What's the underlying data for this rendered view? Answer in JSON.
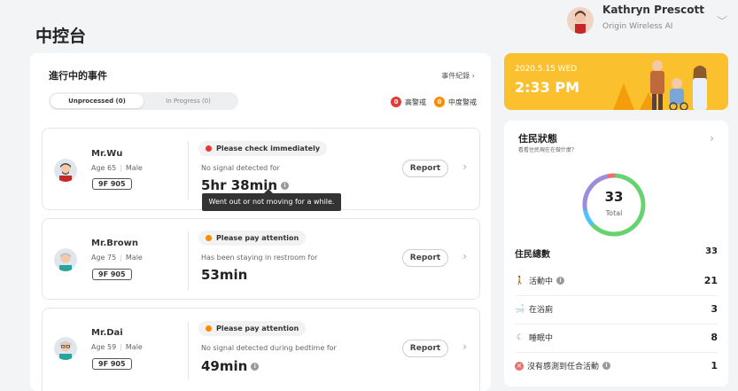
{
  "page": {
    "title": "中控台"
  },
  "user": {
    "name": "Kathryn Prescott",
    "org": "Origin Wireless AI"
  },
  "events": {
    "title": "進行中的事件",
    "log_link": "事件紀錄 ›",
    "tabs": [
      {
        "label": "Unprocessed (0)"
      },
      {
        "label": "In Progress (0)"
      }
    ],
    "legend": [
      {
        "count": "0",
        "label": "高警戒",
        "color": "#e53935"
      },
      {
        "count": "0",
        "label": "中度警戒",
        "color": "#fb8c00"
      }
    ],
    "cards": [
      {
        "name": "Mr.Wu",
        "age": "Age 65",
        "gender": "Male",
        "room": "9F 905",
        "alert": "Please check immediately",
        "alert_color": "#e53935",
        "desc": "No signal detected for",
        "duration": "5hr 38min",
        "info": "i",
        "button": "Report"
      },
      {
        "name": "Mr.Brown",
        "age": "Age 75",
        "gender": "Male",
        "room": "9F 905",
        "alert": "Please pay attention",
        "alert_color": "#fb8c00",
        "desc": "Has been staying in restroom for",
        "duration": "53min",
        "button": "Report"
      },
      {
        "name": "Mr.Dai",
        "age": "Age 59",
        "gender": "Male",
        "room": "9F 905",
        "alert": "Please pay attention",
        "alert_color": "#fb8c00",
        "desc": "No signal detected during bedtime for",
        "duration": "49min",
        "info": "i",
        "button": "Report"
      }
    ],
    "tooltip": "Went out or not moving for a while."
  },
  "banner": {
    "date": "2020.5.15 WED",
    "time": "2:33 PM"
  },
  "status": {
    "title": "住民狀態",
    "subtitle": "看看住民現在在做什麼？",
    "total_value": "33",
    "total_label": "Total",
    "summary_label": "住民總數",
    "summary_value": "33",
    "rows": [
      {
        "icon": "walking-icon",
        "glyph": "🚶",
        "label": "活動中",
        "value": "21",
        "color": "#4caf50",
        "info": "i"
      },
      {
        "icon": "bath-icon",
        "glyph": "🛁",
        "label": "在浴廁",
        "value": "3",
        "color": "#29b6f6"
      },
      {
        "icon": "sleep-icon",
        "glyph": "☾",
        "label": "睡眠中",
        "value": "8",
        "color": "#9575cd"
      },
      {
        "icon": "no-activity-icon",
        "glyph": "✕",
        "label": "沒有感測到任合活動",
        "value": "1",
        "color": "#e57373",
        "info": "i"
      }
    ],
    "donut_segments": [
      {
        "label": "活動中",
        "value": 21,
        "color": "#66d36e"
      },
      {
        "label": "在浴廁",
        "value": 3,
        "color": "#4fc3f7"
      },
      {
        "label": "睡眠中",
        "value": 8,
        "color": "#9c8cd9"
      },
      {
        "label": "沒有感測到任合活動",
        "value": 1,
        "color": "#ef6f6f"
      }
    ]
  }
}
